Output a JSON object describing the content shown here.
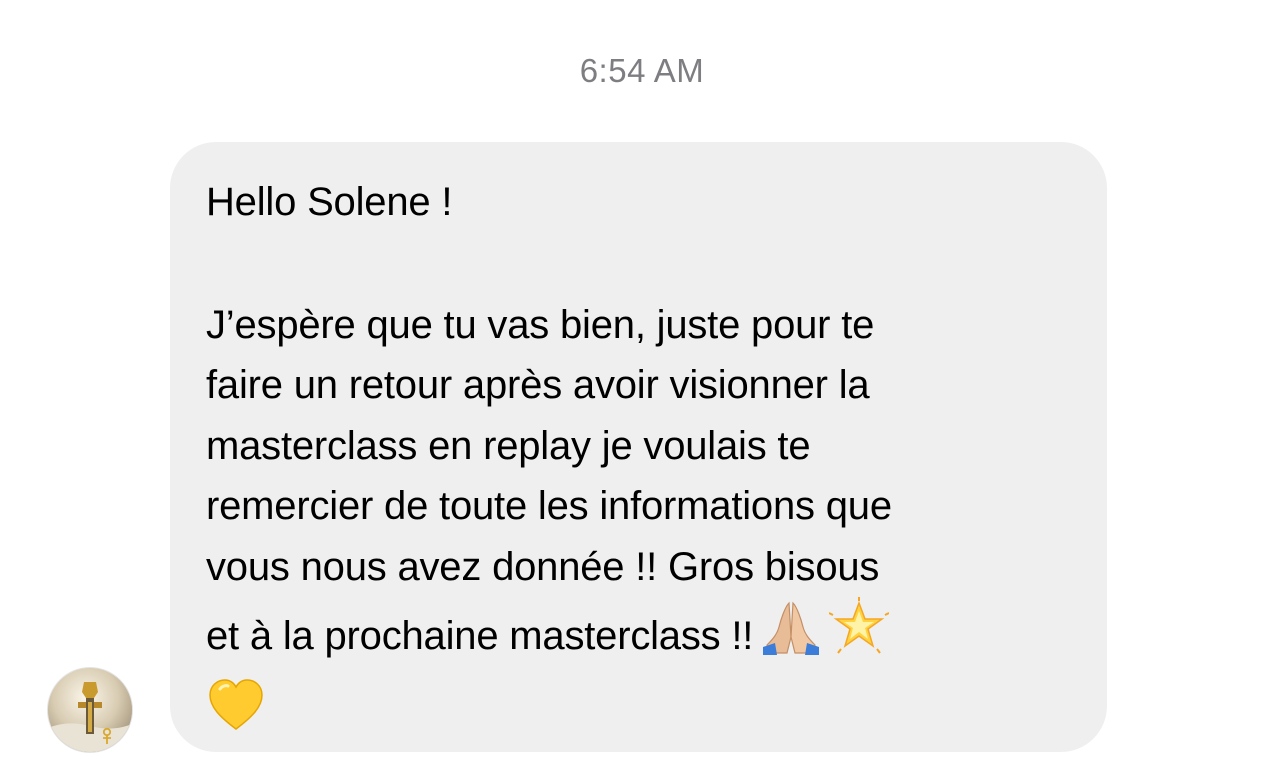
{
  "conversation": {
    "timestamp": "6:54 AM",
    "message": {
      "greeting": "Hello Solene !",
      "body_lines": [
        "J’espère que tu vas bien, juste pour te",
        "faire un retour après avoir visionner la",
        "masterclass en replay je voulais te",
        "remercier de toute les informations que",
        "vous nous avez donnée !! Gros bisous",
        "et à la prochaine masterclass !!"
      ],
      "emojis": [
        "folded-hands-icon",
        "glowing-star-icon",
        "yellow-heart-icon"
      ]
    },
    "colors": {
      "bubble_background": "#efeff0",
      "timestamp_text": "#7d7d82",
      "message_text": "#000000"
    }
  }
}
